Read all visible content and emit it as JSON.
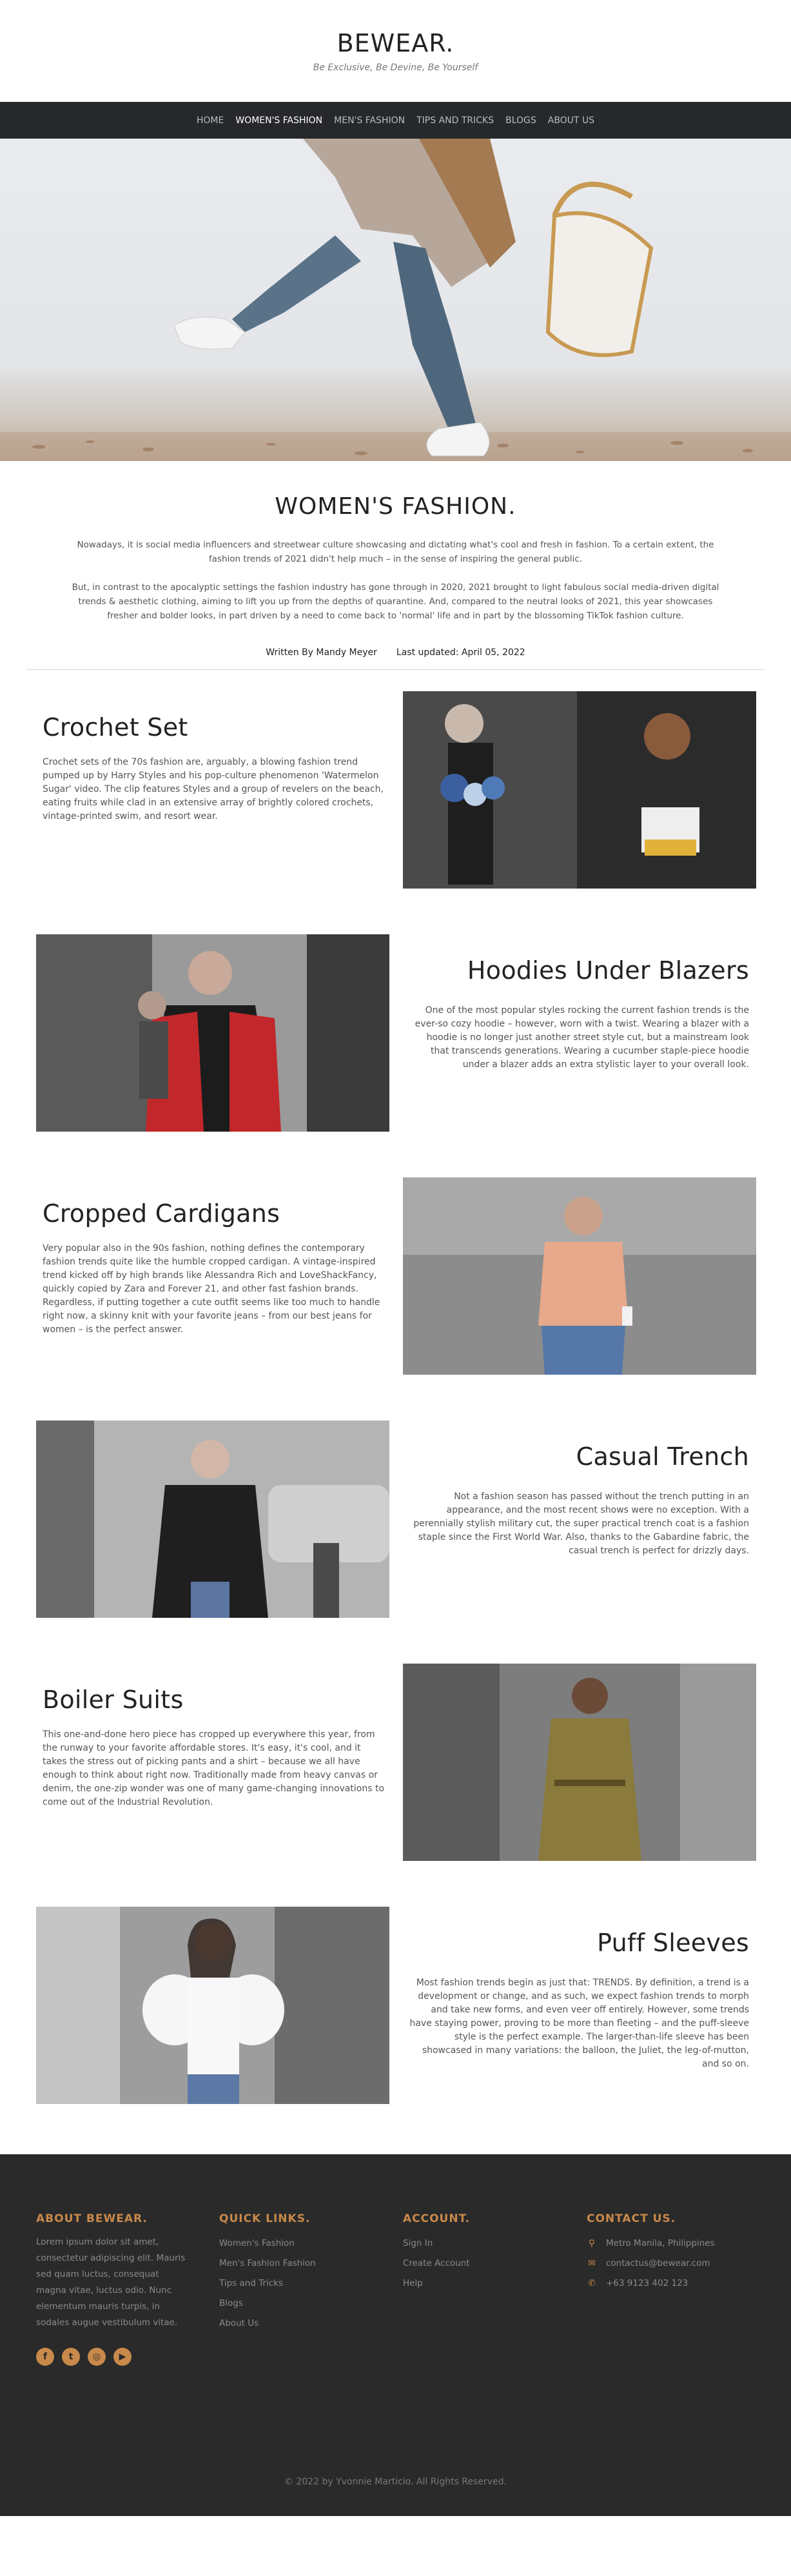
{
  "header": {
    "brand": "BEWEAR.",
    "tagline": "Be Exclusive, Be Devine, Be Yourself"
  },
  "nav": {
    "items": [
      {
        "label": "HOME",
        "active": false
      },
      {
        "label": "WOMEN'S FASHION",
        "active": true
      },
      {
        "label": "MEN'S FASHION",
        "active": false
      },
      {
        "label": "TIPS AND TRICKS",
        "active": false
      },
      {
        "label": "BLOGS",
        "active": false
      },
      {
        "label": "ABOUT US",
        "active": false
      }
    ]
  },
  "intro": {
    "title": "WOMEN'S FASHION.",
    "p1": "Nowadays, it is social media influencers and streetwear culture showcasing and dictating what's cool and fresh in fashion. To a certain extent, the fashion trends of 2021 didn't help much – in the sense of inspiring the general public.",
    "p2": "But, in contrast to the apocalyptic settings the fashion industry has gone through in 2020, 2021 brought to light fabulous social media-driven digital trends & aesthetic clothing, aiming to lift you up from the depths of quarantine. And, compared to the neutral looks of 2021, this year showcases fresher and bolder looks, in part driven by a need to come back to 'normal' life and in part by the blossoming TikTok fashion culture.",
    "author": "Written By Mandy Meyer",
    "updated": "Last updated: April 05, 2022"
  },
  "articles": [
    {
      "title": "Crochet Set",
      "body": "Crochet sets of the 70s fashion are, arguably, a blowing fashion trend pumped up by Harry Styles and his pop-culture phenomenon 'Watermelon Sugar' video. The clip features Styles and a group of revelers on the beach, eating fruits while clad in an extensive array of brightly colored crochets, vintage-printed swim, and resort wear."
    },
    {
      "title": "Hoodies Under Blazers",
      "body": "One of the most popular styles rocking the current fashion trends is the ever-so cozy hoodie – however, worn with a twist. Wearing a blazer with a hoodie is no longer just another street style cut, but a mainstream look that transcends generations. Wearing a cucumber staple-piece hoodie under a blazer adds an extra stylistic layer to your overall look."
    },
    {
      "title": "Cropped Cardigans",
      "body": "Very popular also in the 90s fashion, nothing defines the contemporary fashion trends quite like the humble cropped cardigan. A vintage-inspired trend kicked off by high brands like Alessandra Rich and LoveShackFancy, quickly copied by Zara and Forever 21, and other fast fashion brands. Regardless, if putting together a cute outfit seems like too much to handle right now, a skinny knit with your favorite jeans – from our best jeans for women – is the perfect answer."
    },
    {
      "title": "Casual Trench",
      "body": "Not a fashion season has passed without the trench putting in an appearance, and the most recent shows were no exception. With a perennially stylish military cut, the super practical trench coat is a fashion staple since the First World War. Also, thanks to the Gabardine fabric, the casual trench is perfect for drizzly days."
    },
    {
      "title": "Boiler Suits",
      "body": "This one-and-done hero piece has cropped up everywhere this year, from the runway to your favorite affordable stores. It's easy, it's cool, and it takes the stress out of picking pants and a shirt – because we all have enough to think about right now. Traditionally made from heavy canvas or denim, the one-zip wonder was one of many game-changing innovations to come out of the Industrial Revolution."
    },
    {
      "title": "Puff Sleeves",
      "body": "Most fashion trends begin as just that: TRENDS. By definition, a trend is a development or change, and as such, we expect fashion trends to morph and take new forms, and even veer off entirely. However, some trends have staying power, proving to be more than fleeting – and the puff-sleeve style is the perfect example. The larger-than-life sleeve has been showcased in many variations: the balloon, the Juliet, the leg-of-mutton, and so on."
    }
  ],
  "footer": {
    "about_heading": "ABOUT BEWEAR.",
    "about_text": "Lorem ipsum dolor sit amet, consectetur adipiscing elit. Mauris sed quam luctus, consequat magna vitae, luctus odio. Nunc elementum mauris turpis, in sodales augue vestibulum vitae.",
    "links_heading": "QUICK LINKS.",
    "links": [
      "Women's Fashion",
      "Men's Fashion Fashion",
      "Tips and Tricks",
      "Blogs",
      "About Us"
    ],
    "account_heading": "ACCOUNT.",
    "account": [
      "Sign In",
      "Create Account",
      "Help"
    ],
    "contact_heading": "CONTACT US.",
    "contact": {
      "address": "Metro Manila, Philippines",
      "email": "contactus@bewear.com",
      "phone": "+63 9123 402 123"
    },
    "social_icons": [
      "facebook-icon",
      "twitter-icon",
      "instagram-icon",
      "youtube-icon"
    ],
    "accent_color": "#c8894a",
    "copyright": "© 2022 by Yvonnie Marticio. All Rights Reserved."
  }
}
